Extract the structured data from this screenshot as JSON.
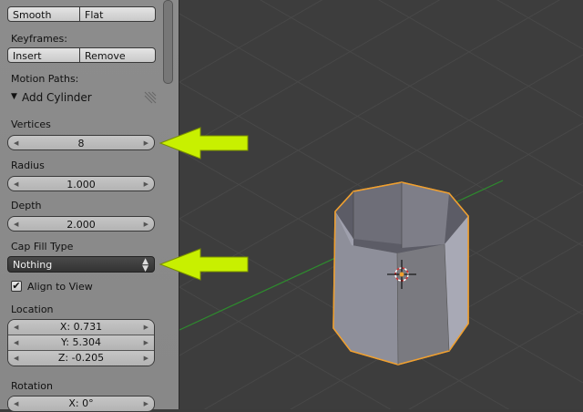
{
  "panel": {
    "shading": {
      "smooth_label": "Smooth",
      "flat_label": "Flat"
    },
    "keyframes": {
      "label": "Keyframes:",
      "insert_label": "Insert",
      "remove_label": "Remove"
    },
    "motion_paths_label": "Motion Paths:",
    "operator": {
      "title": "Add Cylinder",
      "expanded_glyph": "▼"
    },
    "vertices": {
      "label": "Vertices",
      "value": "8"
    },
    "radius": {
      "label": "Radius",
      "value": "1.000"
    },
    "depth": {
      "label": "Depth",
      "value": "2.000"
    },
    "cap_fill": {
      "label": "Cap Fill Type",
      "value": "Nothing",
      "updown_glyph": "▲▼"
    },
    "align_to_view": {
      "label": "Align to View",
      "checked": true,
      "check_glyph": "✔"
    },
    "location": {
      "label": "Location",
      "x": "X: 0.731",
      "y": "Y: 5.304",
      "z": "Z: -0.205"
    },
    "rotation": {
      "label": "Rotation",
      "x": "X: 0°"
    }
  },
  "colors": {
    "panel_bg": "#8a8a8a",
    "viewport_bg": "#3d3d3d",
    "grid_line": "#484848",
    "x_axis": "#2e8b2e",
    "selection_outline": "#f0a030",
    "annotation_arrow": "#c8f000",
    "mesh_light": "#a3a3ad",
    "mesh_dark": "#666670"
  }
}
